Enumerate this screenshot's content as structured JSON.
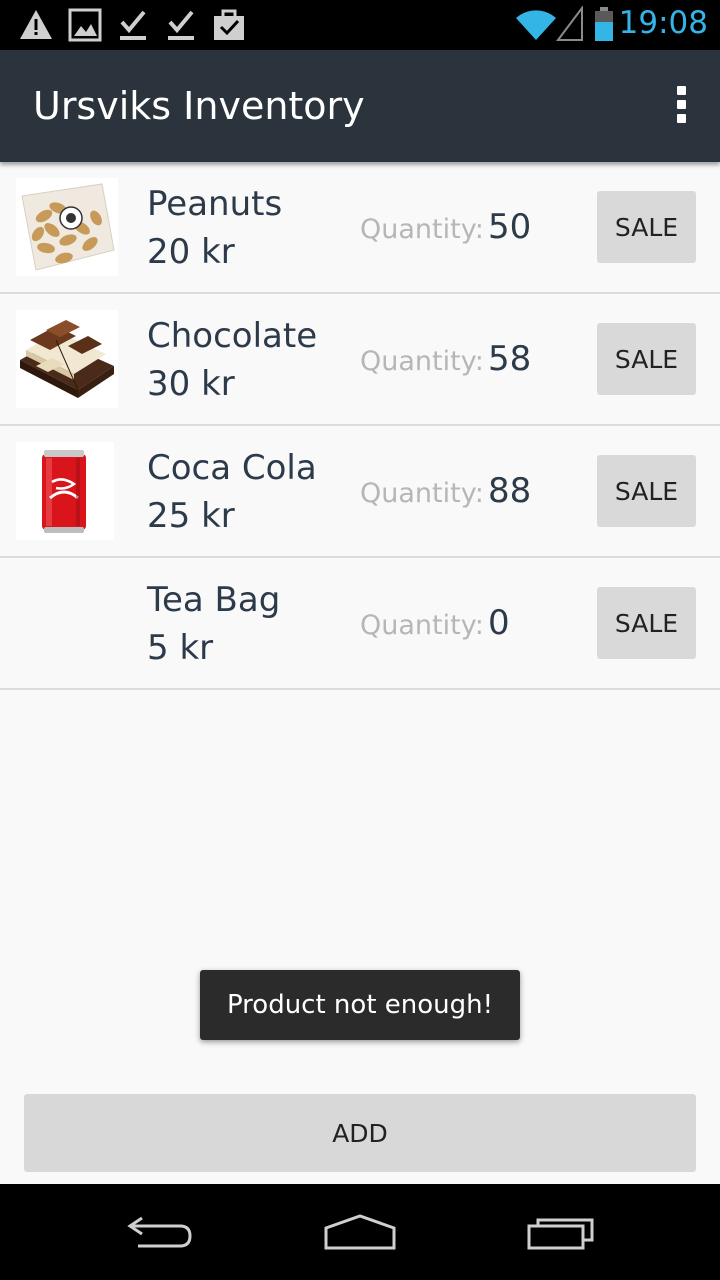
{
  "status_bar": {
    "time": "19:08",
    "left_icons": [
      "warning-icon",
      "image-icon",
      "check-download-icon",
      "check-download-icon",
      "clipboard-check-icon"
    ],
    "right_icons": [
      "wifi-icon",
      "signal-icon",
      "battery-icon"
    ],
    "time_color": "#33b5e5"
  },
  "app_bar": {
    "title": "Ursviks Inventory",
    "overflow_icon": "overflow-menu-icon",
    "background": "#2b333d"
  },
  "products": [
    {
      "name": "Peanuts",
      "price": "20 kr",
      "quantity_label": "Quantity:",
      "quantity": "50",
      "sale_label": "SALE",
      "image": "peanuts-image"
    },
    {
      "name": "Chocolate",
      "price": "30 kr",
      "quantity_label": "Quantity:",
      "quantity": "58",
      "sale_label": "SALE",
      "image": "chocolate-image"
    },
    {
      "name": "Coca Cola",
      "price": "25 kr",
      "quantity_label": "Quantity:",
      "quantity": "88",
      "sale_label": "SALE",
      "image": "coca-cola-can-image"
    },
    {
      "name": "Tea Bag",
      "price": "5 kr",
      "quantity_label": "Quantity:",
      "quantity": "0",
      "sale_label": "SALE",
      "image": ""
    }
  ],
  "toast": {
    "message": "Product not enough!"
  },
  "add_button": {
    "label": "ADD"
  },
  "nav_bar": {
    "icons": [
      "back-icon",
      "home-icon",
      "recent-apps-icon"
    ]
  }
}
